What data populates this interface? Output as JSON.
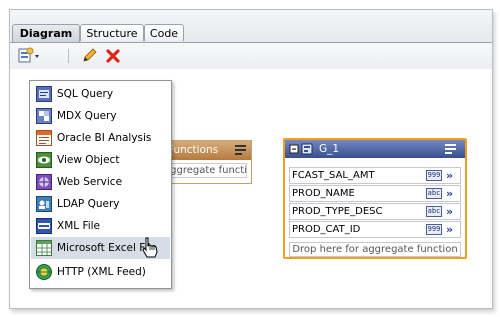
{
  "tabs": [
    {
      "label": "Diagram",
      "active": true
    },
    {
      "label": "Structure",
      "active": false
    },
    {
      "label": "Code",
      "active": false
    }
  ],
  "toolbar": {
    "new_data_set_icon": "new-data-set-icon",
    "edit_icon": "pencil-icon",
    "delete_icon": "delete-x-icon"
  },
  "menu": {
    "items": [
      {
        "label": "SQL Query",
        "icon": "sql-query-icon"
      },
      {
        "label": "MDX Query",
        "icon": "mdx-query-icon"
      },
      {
        "label": "Oracle BI Analysis",
        "icon": "oracle-bi-analysis-icon"
      },
      {
        "label": "View Object",
        "icon": "view-object-icon"
      },
      {
        "label": "Web Service",
        "icon": "web-service-icon"
      },
      {
        "label": "LDAP Query",
        "icon": "ldap-query-icon"
      },
      {
        "label": "XML File",
        "icon": "xml-file-icon"
      },
      {
        "label": "Microsoft Excel File",
        "icon": "excel-file-icon",
        "highlighted": true
      },
      {
        "label": "HTTP (XML Feed)",
        "icon": "http-feed-icon"
      }
    ]
  },
  "functions_box": {
    "title": "Functions",
    "drop_text": "aggregate function"
  },
  "group_box": {
    "title": "G_1",
    "rows": [
      {
        "name": "FCAST_SAL_AMT",
        "type": "999"
      },
      {
        "name": "PROD_NAME",
        "type": "abc"
      },
      {
        "name": "PROD_TYPE_DESC",
        "type": "abc"
      },
      {
        "name": "PROD_CAT_ID",
        "type": "999"
      }
    ],
    "drop_text": "Drop here for aggregate function"
  },
  "colors": {
    "accent_orange": "#f0a020",
    "group_header": "#3a4f8f",
    "functions_header": "#b37a3f",
    "menu_highlight": "#d7dde6"
  }
}
